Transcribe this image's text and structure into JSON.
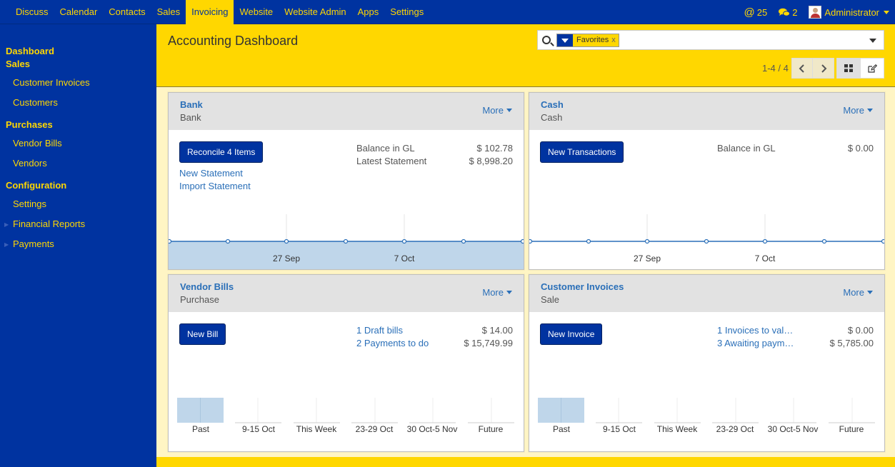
{
  "topnav": {
    "items": [
      "Discuss",
      "Calendar",
      "Contacts",
      "Sales",
      "Invoicing",
      "Website",
      "Website Admin",
      "Apps",
      "Settings"
    ],
    "active": "Invoicing",
    "mentions_count": "25",
    "messages_count": "2",
    "user": "Administrator"
  },
  "sidebar": {
    "dashboard": "Dashboard",
    "sales": "Sales",
    "customer_invoices": "Customer Invoices",
    "customers": "Customers",
    "purchases": "Purchases",
    "vendor_bills": "Vendor Bills",
    "vendors": "Vendors",
    "configuration": "Configuration",
    "settings": "Settings",
    "financial_reports": "Financial Reports",
    "payments": "Payments"
  },
  "control": {
    "title": "Accounting Dashboard",
    "facet": "Favorites",
    "facet_close": "x",
    "pager": "1-4 / 4"
  },
  "cards": {
    "bank": {
      "title": "Bank",
      "subtitle": "Bank",
      "more": "More",
      "button": "Reconcile 4 Items",
      "link1": "New Statement",
      "link2": "Import Statement",
      "label1": "Balance in GL",
      "value1": "$ 102.78",
      "label2": "Latest Statement",
      "value2": "$ 8,998.20",
      "x_labels": [
        "27 Sep",
        "7 Oct"
      ]
    },
    "cash": {
      "title": "Cash",
      "subtitle": "Cash",
      "more": "More",
      "button": "New Transactions",
      "label1": "Balance in GL",
      "value1": "$ 0.00",
      "x_labels": [
        "27 Sep",
        "7 Oct"
      ]
    },
    "vendor_bills": {
      "title": "Vendor Bills",
      "subtitle": "Purchase",
      "more": "More",
      "button": "New Bill",
      "link1": "1 Draft bills",
      "value1": "$ 14.00",
      "link2": "2 Payments to do",
      "value2": "$ 15,749.99",
      "categories": [
        "Past",
        "9-15 Oct",
        "This Week",
        "23-29 Oct",
        "30 Oct-5 Nov",
        "Future"
      ]
    },
    "customer_invoices": {
      "title": "Customer Invoices",
      "subtitle": "Sale",
      "more": "More",
      "button": "New Invoice",
      "link1": "1 Invoices to val…",
      "value1": "$ 0.00",
      "link2": "3 Awaiting paym…",
      "value2": "$ 5,785.00",
      "categories": [
        "Past",
        "9-15 Oct",
        "This Week",
        "23-29 Oct",
        "30 Oct-5 Nov",
        "Future"
      ]
    }
  },
  "colors": {
    "brand_blue": "#0033A0",
    "brand_yellow": "#FFD700",
    "link_blue": "#2a6fb8"
  }
}
